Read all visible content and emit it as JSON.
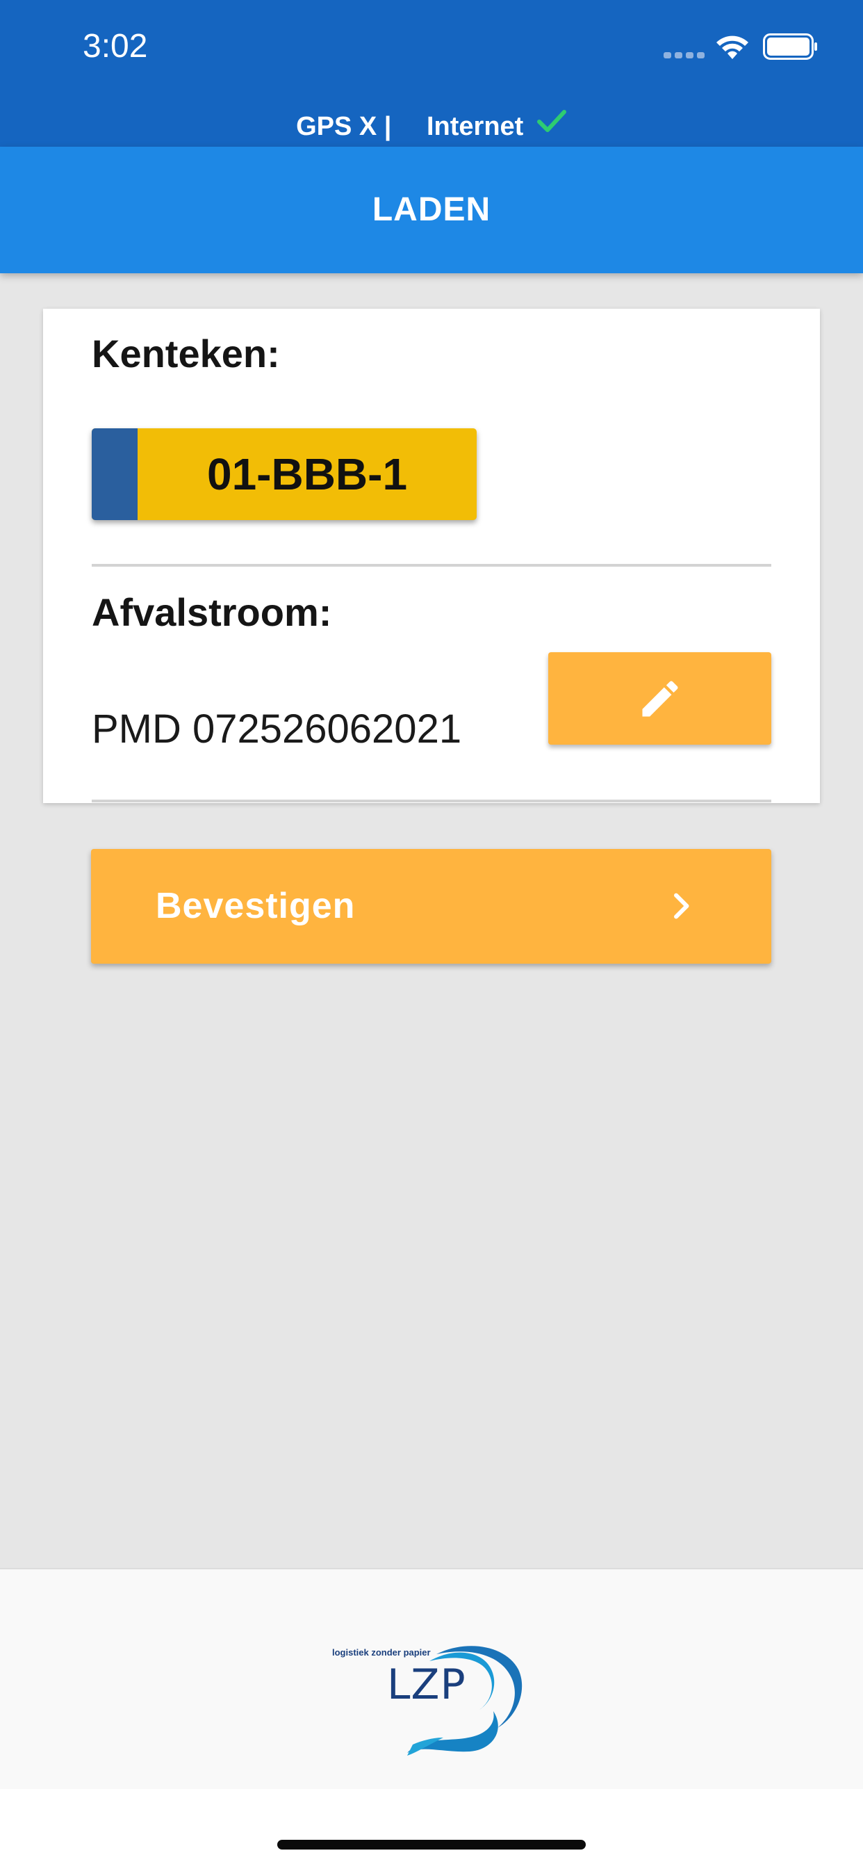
{
  "status_bar": {
    "time": "3:02",
    "gps_label": "GPS X |",
    "internet_label": "Internet",
    "icons": [
      "signal-dots-icon",
      "wifi-icon",
      "battery-icon",
      "check-icon"
    ],
    "check_color": "#2ecc71"
  },
  "header": {
    "title": "LADEN",
    "color": "#1e88e5"
  },
  "card": {
    "plate_label": "Kenteken:",
    "plate_number": "01-BBB-1",
    "plate_color": "#f2bd06",
    "plate_strip_color": "#2a5f9e",
    "waste_label": "Afvalstroom:",
    "waste_value": "PMD 072526062021",
    "edit_icon": "pencil-icon"
  },
  "actions": {
    "confirm_label": "Bevestigen",
    "confirm_icon": "chevron-right-icon",
    "accent_color": "#ffb43f"
  },
  "footer": {
    "logo_tagline": "logistiek zonder papier",
    "logo_text": "LZP"
  }
}
